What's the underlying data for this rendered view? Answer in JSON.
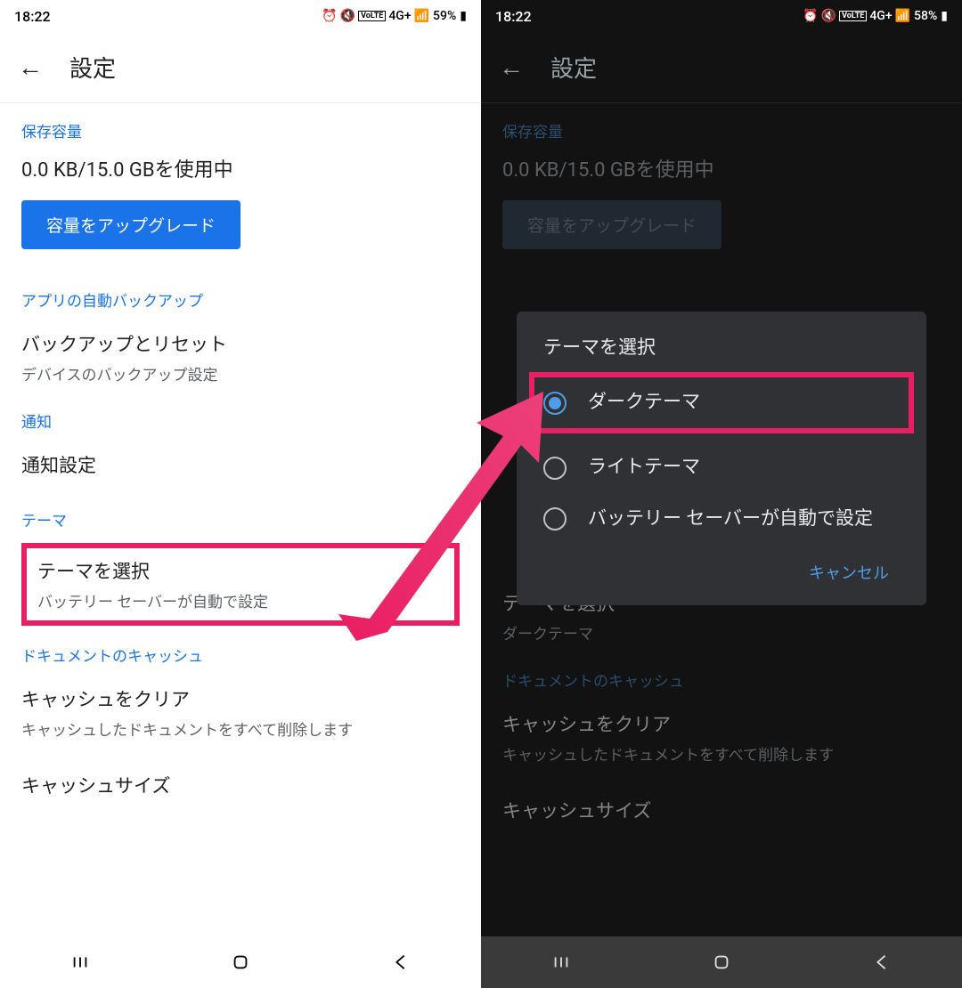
{
  "left": {
    "status": {
      "time": "18:22",
      "battery": "59%",
      "network": "4G+"
    },
    "app_bar": {
      "title": "設定"
    },
    "storage": {
      "header": "保存容量",
      "text": "0.0 KB/15.0 GBを使用中",
      "button": "容量をアップグレード"
    },
    "backup": {
      "header": "アプリの自動バックアップ",
      "title": "バックアップとリセット",
      "subtitle": "デバイスのバックアップ設定"
    },
    "notif": {
      "header": "通知",
      "title": "通知設定"
    },
    "theme": {
      "header": "テーマ",
      "title": "テーマを選択",
      "subtitle": "バッテリー セーバーが自動で設定"
    },
    "cache": {
      "header": "ドキュメントのキャッシュ",
      "title": "キャッシュをクリア",
      "subtitle": "キャッシュしたドキュメントをすべて削除します"
    },
    "cachesize": {
      "title": "キャッシュサイズ"
    }
  },
  "right": {
    "status": {
      "time": "18:22",
      "battery": "58%",
      "network": "4G+"
    },
    "app_bar": {
      "title": "設定"
    },
    "storage": {
      "header": "保存容量",
      "text": "0.0 KB/15.0 GBを使用中",
      "button": "容量をアップグレード"
    },
    "theme_under": {
      "title": "テーマを選択",
      "subtitle": "ダークテーマ"
    },
    "cache": {
      "header": "ドキュメントのキャッシュ",
      "title": "キャッシュをクリア",
      "subtitle": "キャッシュしたドキュメントをすべて削除します"
    },
    "cachesize": {
      "title": "キャッシュサイズ"
    },
    "dialog": {
      "title": "テーマを選択",
      "opt_dark": "ダークテーマ",
      "opt_light": "ライトテーマ",
      "opt_batt": "バッテリー セーバーが自動で設定",
      "cancel": "キャンセル"
    }
  }
}
